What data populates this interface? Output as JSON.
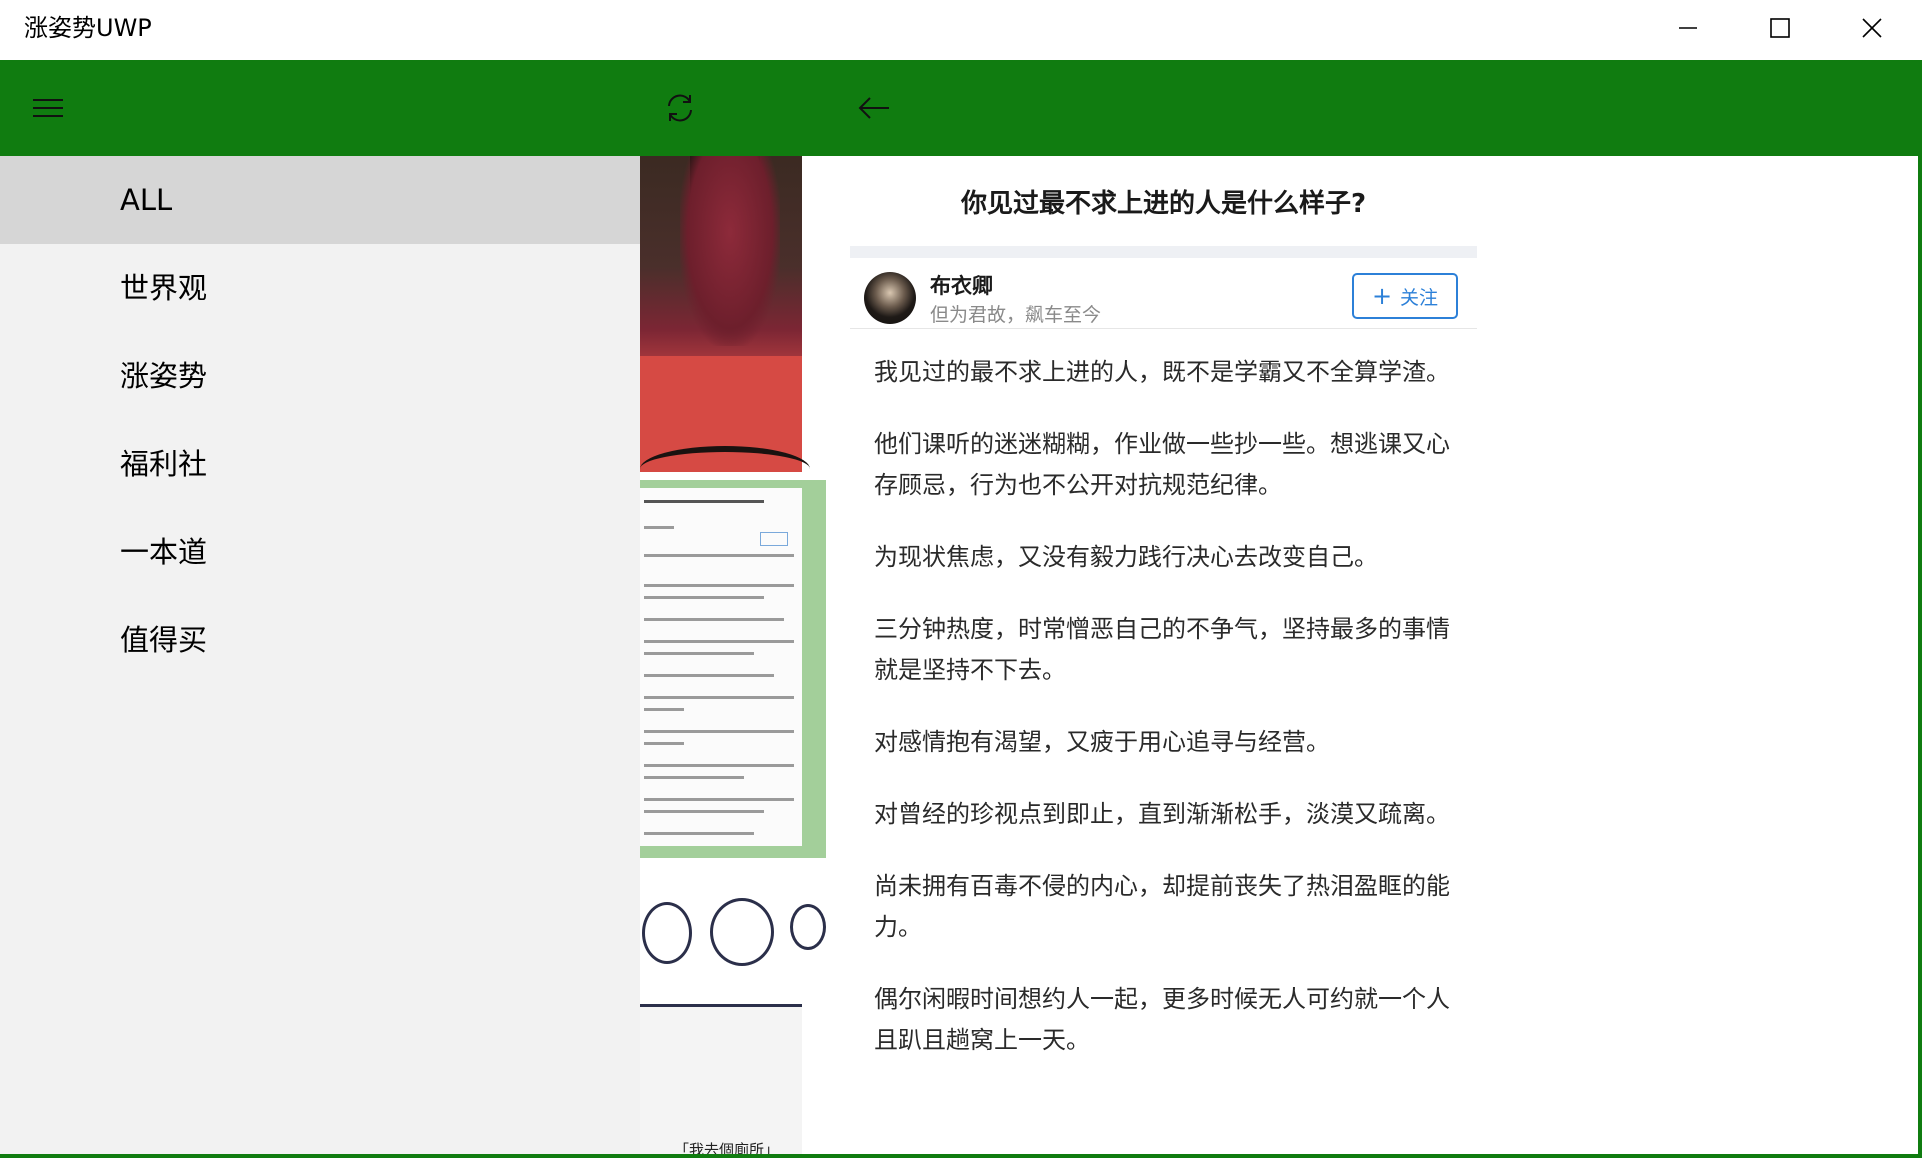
{
  "window": {
    "title": "涨姿势UWP",
    "controls": {
      "minimize_icon": "minimize-icon",
      "maximize_icon": "maximize-icon",
      "close_icon": "close-icon"
    }
  },
  "appbar": {
    "background": "#107c10",
    "icons": [
      "hamburger-icon",
      "refresh-icon",
      "back-arrow-icon"
    ]
  },
  "nav": {
    "selected_index": 0,
    "items": [
      {
        "label": "ALL"
      },
      {
        "label": "世界观"
      },
      {
        "label": "涨姿势"
      },
      {
        "label": "福利社"
      },
      {
        "label": "一本道"
      },
      {
        "label": "值得买"
      }
    ]
  },
  "thumbs": {
    "comic_caption": "「我去個廁所」"
  },
  "article": {
    "title": "你见过最不求上进的人是什么样子?",
    "author": {
      "name": "布衣卿",
      "bio": "但为君故，飙车至今"
    },
    "follow_label": "关注",
    "paragraphs": [
      "我见过的最不求上进的人，既不是学霸又不全算学渣。",
      "他们课听的迷迷糊糊，作业做一些抄一些。想逃课又心存顾忌，行为也不公开对抗规范纪律。",
      "为现状焦虑，又没有毅力践行决心去改变自己。",
      "三分钟热度，时常憎恶自己的不争气，坚持最多的事情就是坚持不下去。",
      "对感情抱有渴望，又疲于用心追寻与经营。",
      "对曾经的珍视点到即止，直到渐渐松手，淡漠又疏离。",
      "尚未拥有百毒不侵的内心，却提前丧失了热泪盈眶的能力。",
      "偶尔闲暇时间想约人一起，更多时候无人可约就一个人且趴且趟窝上一天。"
    ]
  }
}
